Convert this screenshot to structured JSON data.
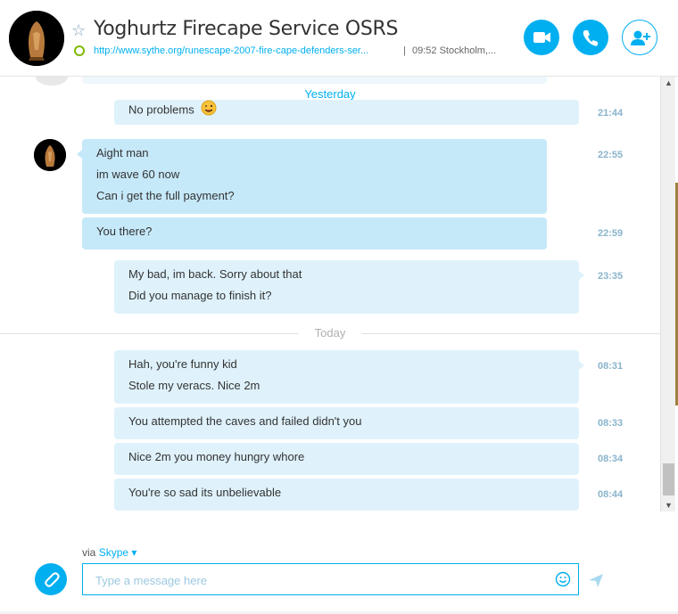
{
  "header": {
    "contact_name": "Yoghurtz Firecape Service OSRS",
    "mood_link": "http://www.sythe.org/runescape-2007-fire-cape-defenders-ser...",
    "separator": "|",
    "local_info": "09:52 Stockholm,...",
    "buttons": {
      "video": "video-call",
      "call": "audio-call",
      "add": "add-people"
    }
  },
  "chat": {
    "yesterday_label": "Yesterday",
    "today_label": "Today",
    "messages": [
      {
        "text": "No problems",
        "time": "21:44",
        "emoji": "wink-tongue"
      },
      {
        "lines": [
          "Aight man",
          "im wave 60 now",
          "Can i get the full payment?"
        ],
        "time": "22:55"
      },
      {
        "text": "You there?",
        "time": "22:59"
      },
      {
        "lines": [
          "My bad, im back. Sorry about that",
          "Did you manage to finish it?"
        ],
        "time": "23:35"
      },
      {
        "lines": [
          "Hah, you're funny kid",
          "Stole my veracs. Nice 2m"
        ],
        "time": "08:31"
      },
      {
        "text": "You attempted the caves and failed didn't you",
        "time": "08:33"
      },
      {
        "text": "Nice 2m you money hungry whore",
        "time": "08:34"
      },
      {
        "text": "You're so sad its unbelievable",
        "time": "08:44"
      }
    ]
  },
  "composer": {
    "via": "via",
    "via_link": "Skype ▾",
    "placeholder": "Type a message here"
  },
  "colors": {
    "accent": "#00aff0",
    "bubble_in": "#c6e9fa",
    "bubble_out": "#dff2fc",
    "status_online": "#7fba00"
  }
}
